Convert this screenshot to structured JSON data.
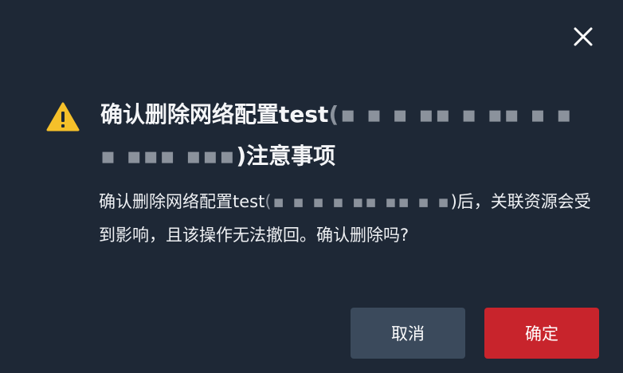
{
  "dialog": {
    "title_prefix": "确认删除网络配置test",
    "title_redacted": "(▪ ▪ ▪ ▪▪ ▪ ▪▪ ▪ ▪ ▪ ▪▪▪ ▪▪▪",
    "title_suffix": ")注意事项",
    "body_prefix": "确认删除网络配置test",
    "body_redacted": "(▪ ▪ ▪ ▪ ▪▪ ▪▪ ▪ ▪",
    "body_suffix": ")后，关联资源会受到影响，且该操作无法撤回。确认删除吗?",
    "cancel_label": "取消",
    "confirm_label": "确定"
  },
  "icons": {
    "close": "close-icon",
    "warning": "warning-icon"
  },
  "colors": {
    "background": "#1e2836",
    "warning": "#f5c02a",
    "cancel_button": "#3b4a5c",
    "confirm_button": "#c8242c"
  }
}
